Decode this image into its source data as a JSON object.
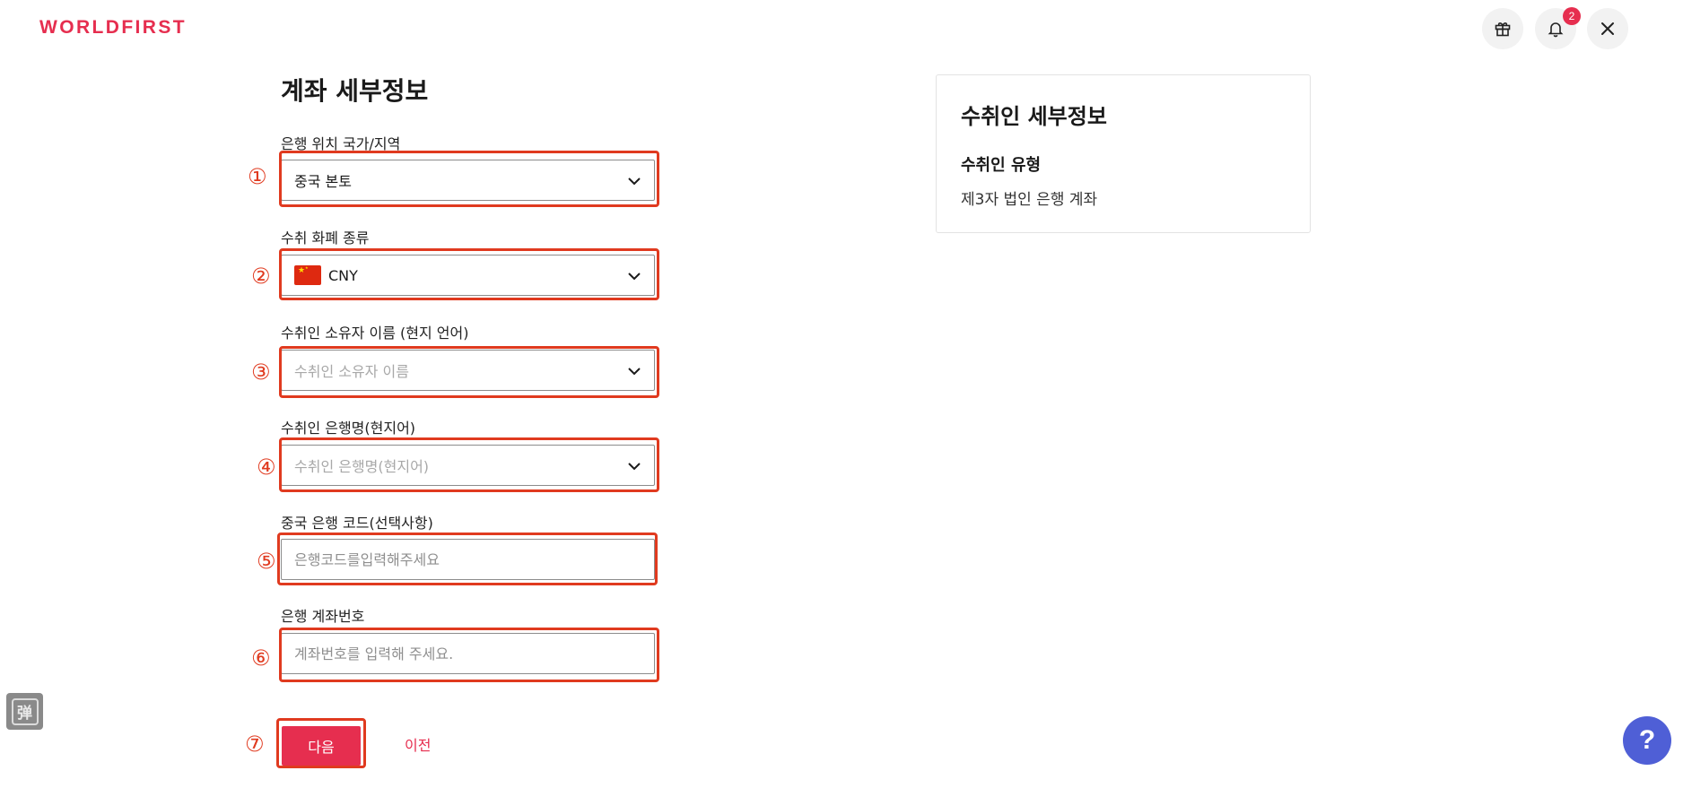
{
  "header": {
    "logo_text": "WORLDFIRST",
    "notification_count": "2",
    "icons": [
      "gift-icon",
      "bell-icon",
      "close-icon"
    ]
  },
  "form": {
    "title": "계좌 세부정보",
    "fields": [
      {
        "label": "은행 위치 국가/지역",
        "value": "중국 본토",
        "type": "select"
      },
      {
        "label": "수취 화폐 종류",
        "value": "CNY",
        "type": "select",
        "icon": "china-flag-icon"
      },
      {
        "label": "수취인 소유자 이름 (현지 언어)",
        "placeholder": "수취인 소유자 이름",
        "type": "select"
      },
      {
        "label": "수취인 은행명(현지어)",
        "placeholder": "수취인 은행명(현지어)",
        "type": "select"
      },
      {
        "label": "중국 은행 코드(선택사항)",
        "placeholder": "은행코드를입력해주세요",
        "type": "input"
      },
      {
        "label": "은행 계좌번호",
        "placeholder": "계좌번호를 입력해 주세요.",
        "type": "input"
      }
    ],
    "next_label": "다음",
    "prev_label": "이전"
  },
  "annotations": [
    "①",
    "②",
    "③",
    "④",
    "⑤",
    "⑥",
    "⑦"
  ],
  "summary_card": {
    "title": "수취인 세부정보",
    "subtitle": "수취인 유형",
    "value": "제3자 법인 은행 계좌"
  },
  "side_widget": {
    "glyph": "弹"
  },
  "help": {
    "label": "?"
  },
  "colors": {
    "brand": "#e62e4f",
    "annotation": "#e03a1f",
    "help": "#4f5fd6"
  }
}
